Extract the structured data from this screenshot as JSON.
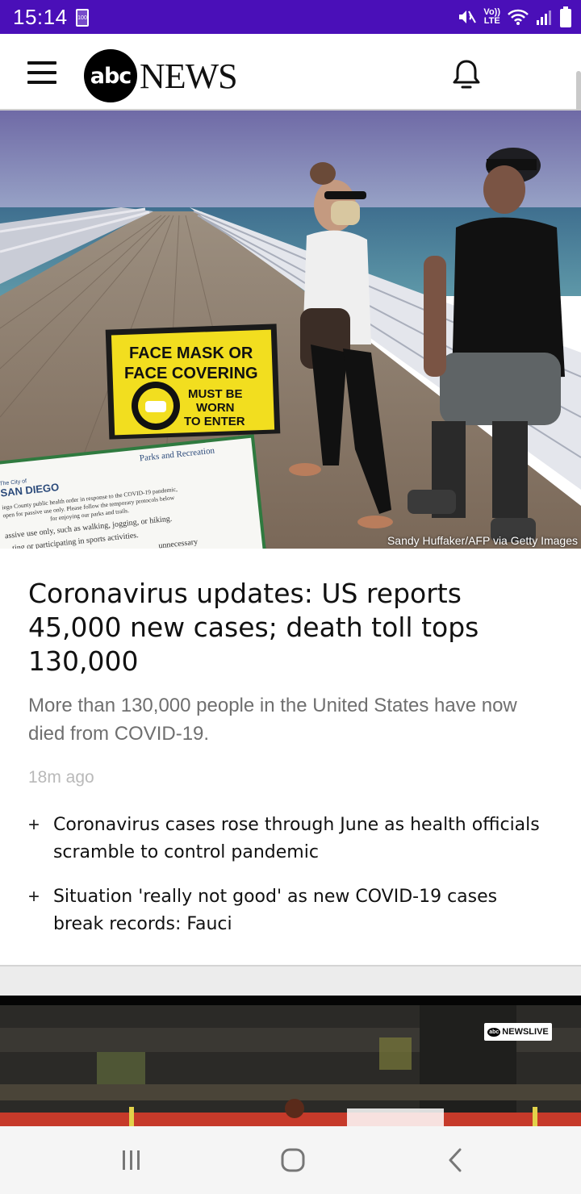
{
  "status_bar": {
    "time": "15:14",
    "battery_level_label": "100",
    "network_label_top": "Vo))",
    "network_label_bottom": "LTE",
    "icons": [
      "battery-saver-icon",
      "mute-icon",
      "wifi-icon",
      "signal-icon",
      "battery-icon"
    ],
    "background_color": "#4a0fb8"
  },
  "app_bar": {
    "logo_abc": "abc",
    "logo_news": "NEWS",
    "icons": [
      "menu-icon",
      "bell-icon"
    ]
  },
  "hero": {
    "photo_credit": "Sandy Huffaker/AFP via Getty Images",
    "sign_text": [
      "FACE MASK OR",
      "FACE COVERING",
      "MUST BE",
      "WORN",
      "TO ENTER"
    ],
    "board_text": {
      "city_prefix": "The City of",
      "city": "SAN DIEGO",
      "dept": "Parks and Recreation",
      "line1": "iego County public health order in response to the COVID-19 pandemic,",
      "line2": "open for passive use only. Please follow the temporary protocols below",
      "line3": "for enjoying our parks and trails.",
      "line4": "assive use only, such as walking, jogging, or hiking.",
      "line5": "...ting or participating in sports activities.",
      "line6": "unnecessary"
    }
  },
  "article": {
    "headline": "Coronavirus updates: US reports 45,000 new cases; death toll tops 130,000",
    "summary": "More than 130,000 people in the United States have now died from COVID-19.",
    "timestamp": "18m ago",
    "related": [
      {
        "icon": "+",
        "text": "Coronavirus cases rose through June as health officials scramble to control pandemic"
      },
      {
        "icon": "+",
        "text": "Situation 'really not good' as new COVID-19 cases break records: Fauci"
      }
    ]
  },
  "video_card": {
    "badge_abc": "abc",
    "badge_text": "NEWSLIVE"
  },
  "nav_bar": {
    "icons": [
      "recent-apps-icon",
      "home-icon",
      "back-icon"
    ]
  }
}
